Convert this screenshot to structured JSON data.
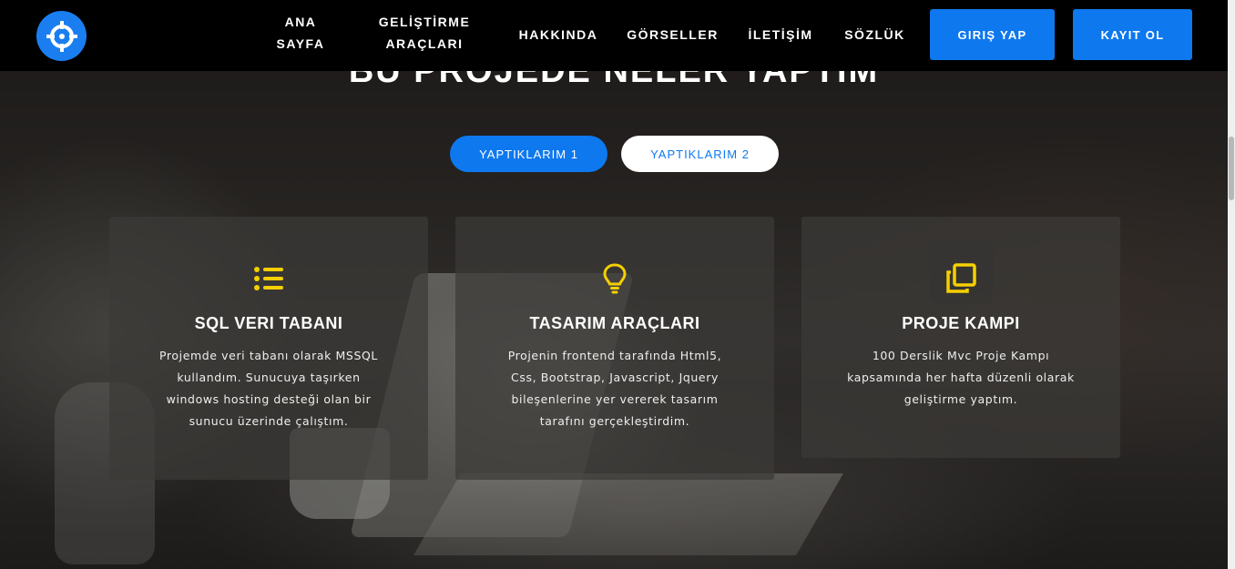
{
  "colors": {
    "primary": "#0e78ee",
    "accent_icon": "#f5d000",
    "navbar_bg": "#000000"
  },
  "nav": {
    "items": [
      {
        "line1": "ANA",
        "line2": "SAYFA"
      },
      {
        "line1": "GELİŞTİRME",
        "line2": "ARAÇLARI"
      },
      {
        "label": "HAKKINDA"
      },
      {
        "label": "GÖRSELLER"
      },
      {
        "label": "İLETİŞİM"
      },
      {
        "label": "SÖZLÜK"
      }
    ],
    "login_label": "GIRIŞ YAP",
    "register_label": "KAYIT OL"
  },
  "section": {
    "title": "BU PROJEDE NELER YAPTIM"
  },
  "tabs": [
    {
      "label": "YAPTIKLARIM 1",
      "active": true
    },
    {
      "label": "YAPTIKLARIM 2",
      "active": false
    }
  ],
  "cards": [
    {
      "icon": "list-icon",
      "title": "SQL VERI TABANI",
      "lines": [
        "Projemde veri tabanı olarak MSSQL",
        "kullandım. Sunucuya taşırken",
        "windows hosting desteği olan bir",
        "sunucu üzerinde çalıştım."
      ]
    },
    {
      "icon": "lightbulb-icon",
      "title": "TASARIM ARAÇLARI",
      "lines": [
        "Projenin frontend tarafında Html5,",
        "Css, Bootstrap, Javascript, Jquery",
        "bileşenlerine yer vererek tasarım",
        "tarafını gerçekleştirdim."
      ]
    },
    {
      "icon": "copy-icon",
      "title": "PROJE KAMPI",
      "lines": [
        "100 Derslik Mvc Proje Kampı",
        "kapsamında her hafta düzenli olarak",
        "geliştirme yaptım."
      ]
    }
  ]
}
